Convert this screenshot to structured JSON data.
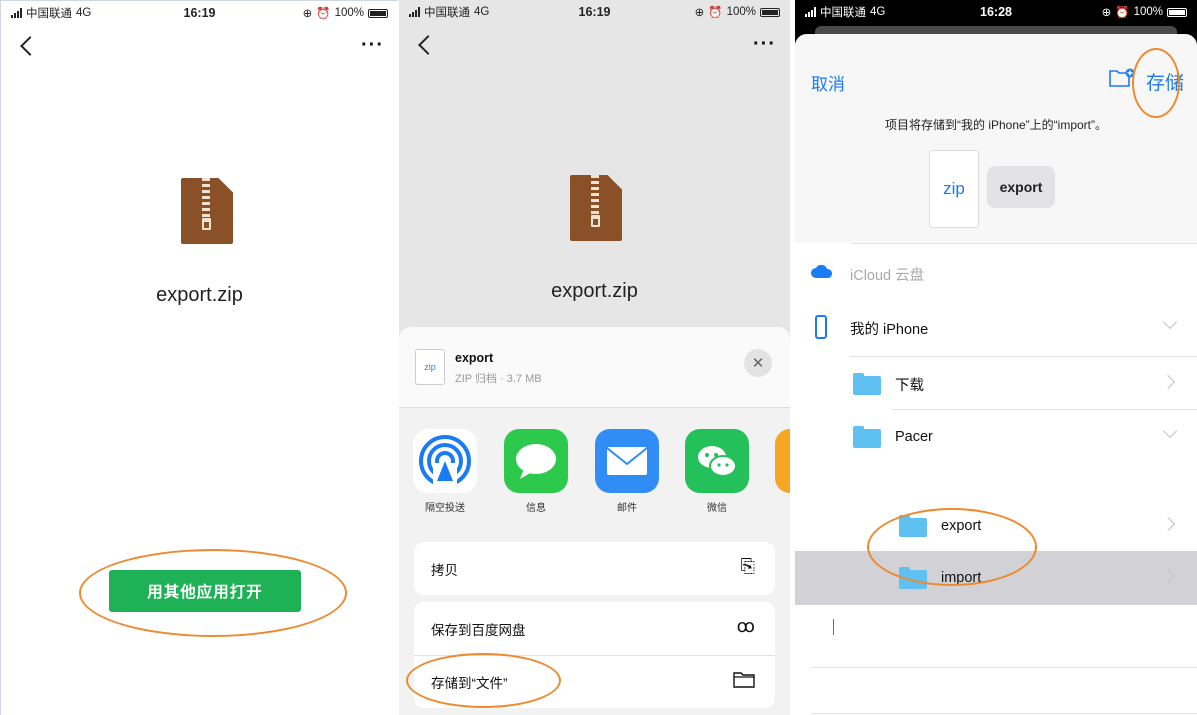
{
  "status_bars": [
    {
      "carrier": "中国联通",
      "network": "4G",
      "time": "16:19",
      "battery": "100%"
    },
    {
      "carrier": "中国联通",
      "network": "4G",
      "time": "16:19",
      "battery": "100%"
    },
    {
      "carrier": "中国联通",
      "network": "4G",
      "time": "16:28",
      "battery": "100%"
    }
  ],
  "panel1": {
    "more_label": "···",
    "file_name": "export.zip",
    "open_with_button": "用其他应用打开"
  },
  "panel2": {
    "more_label": "···",
    "file_name": "export.zip",
    "sheet": {
      "doc_label": "zip",
      "title": "export",
      "subtitle": "ZIP 归档 · 3.7 MB",
      "close_label": "✕"
    },
    "apps": [
      {
        "label": "隔空投送",
        "icon": "airdrop-icon"
      },
      {
        "label": "信息",
        "icon": "messages-icon"
      },
      {
        "label": "邮件",
        "icon": "mail-icon"
      },
      {
        "label": "微信",
        "icon": "wechat-icon"
      }
    ],
    "actions": [
      {
        "label": "拷贝",
        "icon": "copy-icon"
      },
      {
        "label": "保存到百度网盘",
        "icon": "baidu-netdisk-icon"
      },
      {
        "label": "存储到“文件”",
        "icon": "folder-icon"
      }
    ]
  },
  "panel3": {
    "cancel": "取消",
    "save": "存储",
    "hint": "项目将存储到“我的 iPhone”上的“import”。",
    "zip_label": "zip",
    "export_chip": "export",
    "locations": [
      {
        "label": "iCloud 云盘",
        "enabled": false
      },
      {
        "label": "我的 iPhone",
        "expanded": true
      },
      {
        "label": "下载"
      },
      {
        "label": "Pacer",
        "expanded": true
      },
      {
        "label": "export"
      },
      {
        "label": "import",
        "selected": true
      }
    ]
  },
  "colors": {
    "accent_green": "#1fb155",
    "ios_blue": "#1a7bf2",
    "highlight_orange": "#ee8a2e",
    "zip_brown": "#8a5027",
    "selected_row": "#d1d1d6"
  }
}
